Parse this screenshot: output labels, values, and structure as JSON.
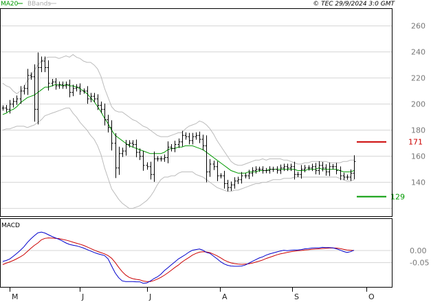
{
  "header": {
    "legend_ma": "MA20",
    "legend_bands": "BBands",
    "copyright": "© TEC 29/9/2024 3:0 GMT"
  },
  "colors": {
    "ma": "#009900",
    "bands": "#bbbbbb",
    "bars": "#000000",
    "grid": "#d4d4d4",
    "resistance": "#cc0000",
    "support": "#009900",
    "macd": "#0000cc",
    "signal": "#cc0000"
  },
  "chart_data": [
    {
      "type": "ohlc",
      "panel": "price",
      "y_ticks": [
        140,
        160,
        180,
        200,
        220,
        240,
        260
      ],
      "ylim": [
        114,
        273
      ],
      "x_labels": [
        "M",
        "J",
        "J",
        "A",
        "S",
        "O"
      ],
      "levels": {
        "resistance": {
          "value": 171,
          "label": "171"
        },
        "support": {
          "value": 129,
          "label": "129"
        }
      },
      "close": [
        197,
        196,
        200,
        202,
        204,
        210,
        212,
        222,
        221,
        196,
        228,
        233,
        228,
        216,
        217,
        214,
        215,
        214,
        215,
        209,
        212,
        213,
        210,
        210,
        204,
        206,
        204,
        199,
        196,
        188,
        182,
        170,
        151,
        162,
        164,
        169,
        170,
        169,
        163,
        160,
        153,
        152,
        146,
        158,
        158,
        158,
        159,
        167,
        166,
        169,
        171,
        176,
        175,
        172,
        175,
        176,
        173,
        168,
        148,
        154,
        152,
        145,
        145,
        139,
        136,
        138,
        141,
        142,
        145,
        145,
        147,
        149,
        150,
        150,
        149,
        149,
        150,
        150,
        149,
        151,
        152,
        151,
        152,
        146,
        146,
        150,
        151,
        151,
        152,
        149,
        153,
        151,
        148,
        152,
        152,
        149,
        145,
        144,
        144,
        147,
        156
      ],
      "ma20": [
        192,
        193,
        195,
        196,
        198,
        201,
        203,
        205,
        206,
        207,
        209,
        211,
        213,
        213,
        214,
        215,
        215,
        214,
        215,
        214,
        214,
        213,
        212,
        210,
        208,
        205,
        202,
        198,
        194,
        189,
        185,
        180,
        176,
        174,
        172,
        170,
        168,
        167,
        166,
        165,
        164,
        163,
        162,
        162,
        162,
        162,
        163,
        165,
        166,
        166,
        167,
        167,
        168,
        168,
        168,
        167,
        166,
        165,
        163,
        161,
        159,
        157,
        155,
        153,
        151,
        149,
        148,
        147,
        147,
        147,
        148,
        148,
        148,
        149,
        149,
        149,
        150,
        150,
        150,
        150,
        150,
        150,
        150,
        150,
        149,
        149,
        149,
        150,
        150,
        150,
        151,
        150,
        150,
        150,
        150,
        150,
        149,
        148,
        148,
        148,
        149
      ],
      "upper_band": [
        216,
        214,
        213,
        210,
        208,
        210,
        213,
        218,
        221,
        226,
        230,
        233,
        235,
        236,
        236,
        236,
        235,
        236,
        237,
        236,
        238,
        236,
        235,
        233,
        232,
        232,
        230,
        227,
        221,
        212,
        205,
        198,
        195,
        194,
        194,
        192,
        190,
        188,
        187,
        185,
        183,
        182,
        180,
        178,
        176,
        175,
        175,
        175,
        176,
        177,
        178,
        178,
        181,
        183,
        184,
        185,
        187,
        186,
        184,
        181,
        177,
        172,
        168,
        164,
        160,
        156,
        154,
        153,
        153,
        154,
        155,
        156,
        157,
        157,
        158,
        157,
        158,
        158,
        158,
        158,
        157,
        157,
        156,
        155,
        154,
        154,
        155,
        155,
        156,
        156,
        156,
        156,
        156,
        155,
        155,
        155,
        155,
        156,
        156,
        157,
        157
      ],
      "lower_band": [
        180,
        181,
        181,
        182,
        183,
        183,
        183,
        182,
        183,
        184,
        186,
        188,
        191,
        192,
        193,
        194,
        195,
        196,
        197,
        197,
        193,
        190,
        186,
        183,
        180,
        176,
        173,
        168,
        161,
        151,
        143,
        135,
        131,
        127,
        124,
        122,
        120,
        120,
        121,
        122,
        124,
        126,
        129,
        133,
        138,
        142,
        144,
        144,
        145,
        145,
        147,
        148,
        148,
        148,
        148,
        146,
        145,
        144,
        142,
        140,
        138,
        136,
        135,
        134,
        133,
        133,
        134,
        134,
        135,
        136,
        137,
        138,
        139,
        139,
        140,
        140,
        141,
        142,
        142,
        142,
        143,
        143,
        143,
        144,
        144,
        144,
        144,
        144,
        144,
        144,
        144,
        144,
        144,
        144,
        144,
        144,
        143,
        142,
        141,
        141,
        142
      ]
    },
    {
      "type": "line",
      "panel": "macd",
      "title": "MACD",
      "y_ticks": [
        0,
        -0.05
      ],
      "y_tick_labels": [
        "0.00",
        "-0.05"
      ],
      "ylim": [
        -0.15,
        0.13
      ],
      "macd": [
        -0.045,
        -0.041,
        -0.035,
        -0.024,
        -0.012,
        0.001,
        0.015,
        0.033,
        0.048,
        0.061,
        0.073,
        0.076,
        0.072,
        0.065,
        0.058,
        0.052,
        0.046,
        0.039,
        0.031,
        0.025,
        0.022,
        0.019,
        0.015,
        0.01,
        0.004,
        -0.002,
        -0.008,
        -0.013,
        -0.017,
        -0.021,
        -0.035,
        -0.064,
        -0.092,
        -0.112,
        -0.125,
        -0.128,
        -0.128,
        -0.128,
        -0.129,
        -0.129,
        -0.135,
        -0.134,
        -0.126,
        -0.116,
        -0.109,
        -0.098,
        -0.083,
        -0.071,
        -0.059,
        -0.047,
        -0.035,
        -0.026,
        -0.017,
        -0.007,
        0.001,
        0.004,
        0.006,
        0.001,
        -0.008,
        -0.012,
        -0.023,
        -0.034,
        -0.046,
        -0.055,
        -0.061,
        -0.064,
        -0.065,
        -0.065,
        -0.064,
        -0.06,
        -0.053,
        -0.045,
        -0.038,
        -0.031,
        -0.026,
        -0.019,
        -0.014,
        -0.01,
        -0.006,
        -0.002,
        0.001,
        -0.001,
        0.001,
        0.002,
        0.002,
        0.004,
        0.007,
        0.008,
        0.01,
        0.011,
        0.011,
        0.013,
        0.012,
        0.012,
        0.011,
        0.007,
        0.002,
        -0.004,
        -0.008,
        -0.005,
        0.001
      ],
      "signal": [
        -0.058,
        -0.052,
        -0.047,
        -0.041,
        -0.034,
        -0.026,
        -0.017,
        -0.004,
        0.009,
        0.021,
        0.031,
        0.044,
        0.05,
        0.052,
        0.051,
        0.05,
        0.049,
        0.046,
        0.043,
        0.039,
        0.034,
        0.03,
        0.026,
        0.021,
        0.015,
        0.008,
        0.002,
        -0.004,
        -0.009,
        -0.014,
        -0.021,
        -0.032,
        -0.049,
        -0.069,
        -0.087,
        -0.101,
        -0.111,
        -0.116,
        -0.119,
        -0.121,
        -0.126,
        -0.128,
        -0.128,
        -0.124,
        -0.118,
        -0.111,
        -0.102,
        -0.092,
        -0.081,
        -0.07,
        -0.06,
        -0.048,
        -0.038,
        -0.029,
        -0.019,
        -0.012,
        -0.007,
        -0.005,
        -0.006,
        -0.009,
        -0.015,
        -0.022,
        -0.03,
        -0.039,
        -0.046,
        -0.051,
        -0.054,
        -0.056,
        -0.057,
        -0.056,
        -0.055,
        -0.052,
        -0.048,
        -0.044,
        -0.039,
        -0.033,
        -0.028,
        -0.023,
        -0.018,
        -0.014,
        -0.011,
        -0.008,
        -0.005,
        -0.003,
        -0.001,
        0.0,
        0.002,
        0.003,
        0.005,
        0.006,
        0.007,
        0.008,
        0.009,
        0.01,
        0.01,
        0.01,
        0.008,
        0.005,
        0.002,
        0.001,
        0.0
      ]
    }
  ]
}
